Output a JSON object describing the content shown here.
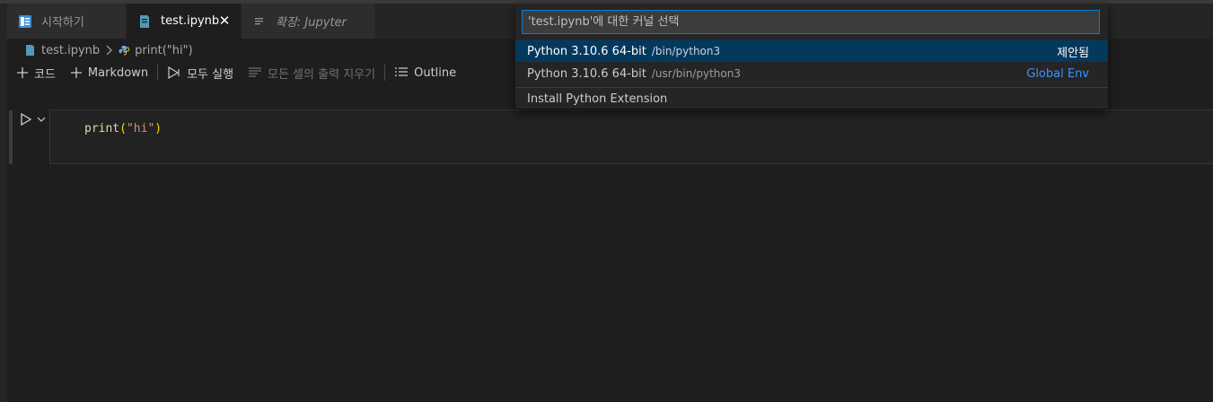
{
  "tabs": [
    {
      "label": "시작하기",
      "icon": "welcome-icon"
    },
    {
      "label": "test.ipynb",
      "icon": "notebook-icon",
      "close": "✕"
    },
    {
      "label": "확장: Jupyter",
      "icon": "preview-icon"
    }
  ],
  "breadcrumb": {
    "file": "test.ipynb",
    "symbol": "print(\"hi\")"
  },
  "toolbar": {
    "add_code": "코드",
    "add_markdown": "Markdown",
    "run_all": "모두 실행",
    "clear_outputs": "모든 셀의 출력 지우기",
    "outline": "Outline"
  },
  "cell": {
    "fn": "print",
    "open": "(",
    "str": "\"hi\"",
    "close": ")"
  },
  "quick_pick": {
    "placeholder": "'test.ipynb'에 대한 커널 선택",
    "items": [
      {
        "name": "Python 3.10.6 64-bit",
        "path": "/bin/python3",
        "tag": "제안됨"
      },
      {
        "name": "Python 3.10.6 64-bit",
        "path": "/usr/bin/python3",
        "tag": "Global Env"
      },
      {
        "name": "Install Python Extension"
      }
    ]
  },
  "colors": {
    "accent": "#007fd4",
    "selection": "#04395e",
    "tag_blue": "#3794ff"
  }
}
